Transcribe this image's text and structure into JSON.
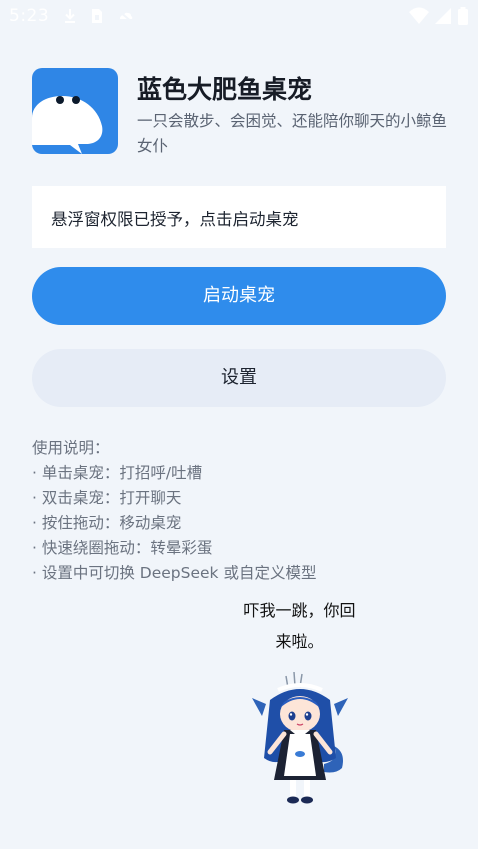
{
  "status_bar": {
    "time": "5:23",
    "left_icons": [
      "download-icon",
      "sim-card-icon",
      "cloud-off-icon"
    ],
    "right_icons": [
      "wifi-icon",
      "cell-signal-icon",
      "battery-icon"
    ]
  },
  "app": {
    "title": "蓝色大肥鱼桌宠",
    "description": "一只会散步、会困觉、还能陪你聊天的小鲸鱼女仆",
    "logo_icon": "whale-logo-icon",
    "brand_color": "#2f86e6"
  },
  "permission": {
    "status_text": "悬浮窗权限已授予，点击启动桌宠"
  },
  "buttons": {
    "start_label": "启动桌宠",
    "settings_label": "设置"
  },
  "usage": {
    "heading": "使用说明：",
    "items": [
      "· 单击桌宠：打招呼/吐槽",
      "· 双击桌宠：打开聊天",
      "· 按住拖动：移动桌宠",
      "· 快速绕圈拖动：转晕彩蛋",
      "· 设置中可切换 DeepSeek 或自定义模型"
    ]
  },
  "pet": {
    "speech_line1": "吓我一跳，你回",
    "speech_line2": "来啦。",
    "character_icon": "whale-maid-character-icon"
  }
}
